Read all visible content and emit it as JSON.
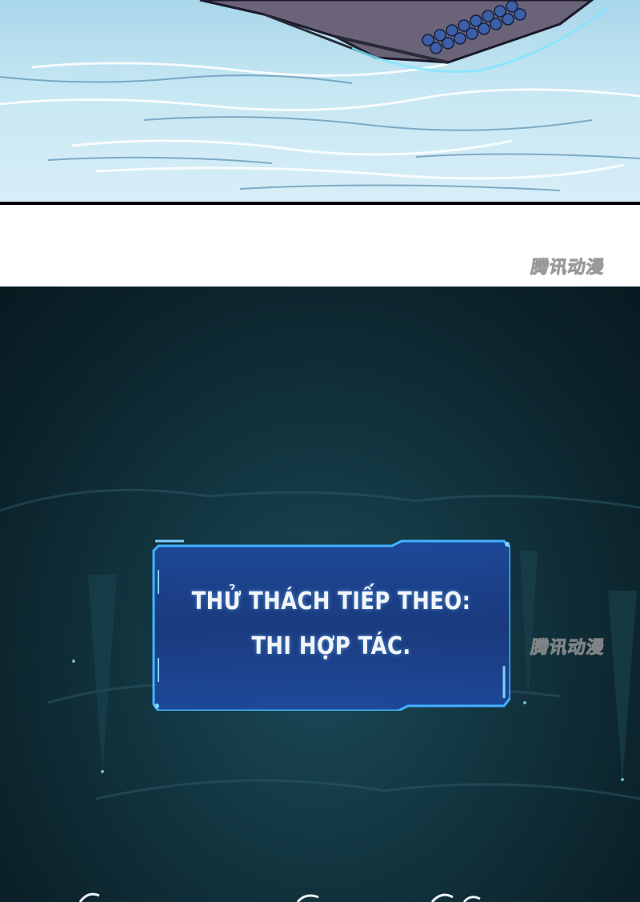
{
  "top_panel": {
    "scene": "raft-on-icy-water"
  },
  "watermarks": {
    "top": "腾讯动漫",
    "side": "腾讯动漫"
  },
  "system_box": {
    "line1": "THỬ THÁCH TIẾP THEO:",
    "line2": "THI HỢP TÁC."
  },
  "colors": {
    "box_border": "#3aa8ff",
    "box_fill": "#1d3d86",
    "cave_dark": "#0c232b",
    "ice_light": "#d7eef7"
  }
}
